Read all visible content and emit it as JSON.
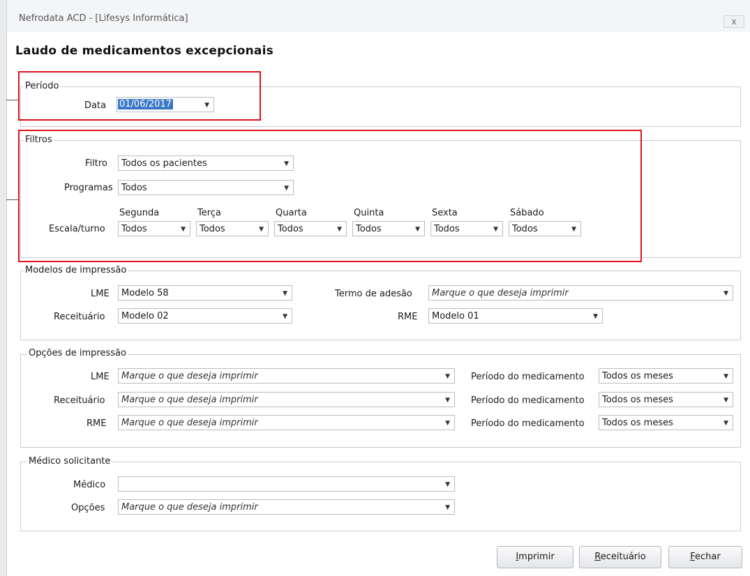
{
  "window": {
    "title": "Nefrodata ACD - [Lifesys Informática]",
    "close_glyph": "x"
  },
  "page_title": "Laudo de medicamentos excepcionais",
  "periodo": {
    "legend": "Período",
    "data_label": "Data",
    "data_value": "01/06/2017"
  },
  "filtros": {
    "legend": "Filtros",
    "filtro_label": "Filtro",
    "filtro_value": "Todos os pacientes",
    "programas_label": "Programas",
    "programas_value": "Todos",
    "escala_label": "Escala/turno",
    "days": [
      {
        "name": "Segunda",
        "value": "Todos"
      },
      {
        "name": "Terça",
        "value": "Todos"
      },
      {
        "name": "Quarta",
        "value": "Todos"
      },
      {
        "name": "Quinta",
        "value": "Todos"
      },
      {
        "name": "Sexta",
        "value": "Todos"
      },
      {
        "name": "Sábado",
        "value": "Todos"
      }
    ]
  },
  "modelos": {
    "legend": "Modelos de impressão",
    "lme_label": "LME",
    "lme_value": "Modelo 58",
    "receituario_label": "Receituário",
    "receituario_value": "Modelo 02",
    "termo_label": "Termo de adesão",
    "termo_value": "Marque o que deseja imprimir",
    "rme_label": "RME",
    "rme_value": "Modelo 01"
  },
  "opcoes": {
    "legend": "Opções de impressão",
    "rows": [
      {
        "label": "LME",
        "value": "Marque o que deseja imprimir",
        "periodo_label": "Período do medicamento",
        "periodo_value": "Todos os meses"
      },
      {
        "label": "Receituário",
        "value": "Marque o que deseja imprimir",
        "periodo_label": "Período do medicamento",
        "periodo_value": "Todos os meses"
      },
      {
        "label": "RME",
        "value": "Marque o que deseja imprimir",
        "periodo_label": "Período do medicamento",
        "periodo_value": "Todos os meses"
      }
    ]
  },
  "medico": {
    "legend": "Médico solicitante",
    "medico_label": "Médico",
    "medico_value": "",
    "opcoes_label": "Opções",
    "opcoes_value": "Marque o que deseja imprimir"
  },
  "buttons": {
    "imprimir": {
      "mnemonic": "I",
      "rest": "mprimir"
    },
    "receituario": {
      "mnemonic": "R",
      "rest": "eceituário"
    },
    "fechar": {
      "mnemonic": "F",
      "rest": "echar"
    }
  },
  "arrow_glyph": "▼"
}
